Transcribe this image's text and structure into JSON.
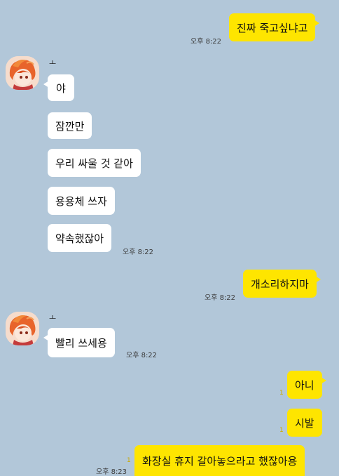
{
  "colors": {
    "background": "#b2c7d9",
    "outgoing_bubble": "#fee500",
    "incoming_bubble": "#ffffff",
    "timestamp": "#3b3b3b"
  },
  "contact": {
    "name": "ㅗ",
    "avatar_icon": "anime-character-avatar-icon"
  },
  "messages": [
    {
      "text": "진짜 죽고싶냐고",
      "time": "오후 8:22"
    },
    {
      "text": "야"
    },
    {
      "text": "잠깐만"
    },
    {
      "text": "우리 싸울 것 같아"
    },
    {
      "text": "용용체 쓰자"
    },
    {
      "text": "약속했잖아",
      "time": "오후 8:22"
    },
    {
      "text": "개소리하지마",
      "time": "오후 8:22"
    },
    {
      "text": "빨리 쓰세용",
      "time": "오후 8:22"
    },
    {
      "text": "아니",
      "read": "1"
    },
    {
      "text": "시발",
      "read": "1"
    },
    {
      "text": "화장실 휴지 갈아놓으라고 했잖아용",
      "read": "1",
      "time": "오후 8:23"
    }
  ]
}
